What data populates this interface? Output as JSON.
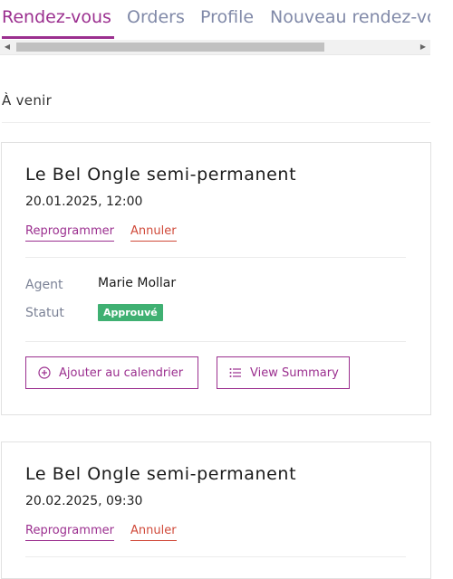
{
  "tabs": [
    {
      "label": "Rendez-vous"
    },
    {
      "label": "Orders"
    },
    {
      "label": "Profile"
    },
    {
      "label": "Nouveau rendez-vous"
    }
  ],
  "section": {
    "title": "À venir"
  },
  "appointments": [
    {
      "title": "Le Bel Ongle semi-permanent",
      "datetime": "20.01.2025, 12:00",
      "reschedule_label": "Reprogrammer",
      "cancel_label": "Annuler",
      "agent_label": "Agent",
      "agent_name": "Marie Mollar",
      "status_label": "Statut",
      "status_value": "Approuvé",
      "add_calendar_label": "Ajouter au calendrier",
      "summary_label": "View Summary"
    },
    {
      "title": "Le Bel Ongle semi-permanent",
      "datetime": "20.02.2025, 09:30",
      "reschedule_label": "Reprogrammer",
      "cancel_label": "Annuler"
    }
  ],
  "colors": {
    "accent": "#9b2f8f",
    "cancel": "#d04a3a",
    "approved": "#3fb072",
    "tab_inactive": "#8089a8"
  },
  "icons": {
    "scroll_left": "scroll-left-arrow-icon",
    "scroll_right": "scroll-right-arrow-icon",
    "add_calendar": "plus-circle-icon",
    "summary": "list-icon"
  }
}
